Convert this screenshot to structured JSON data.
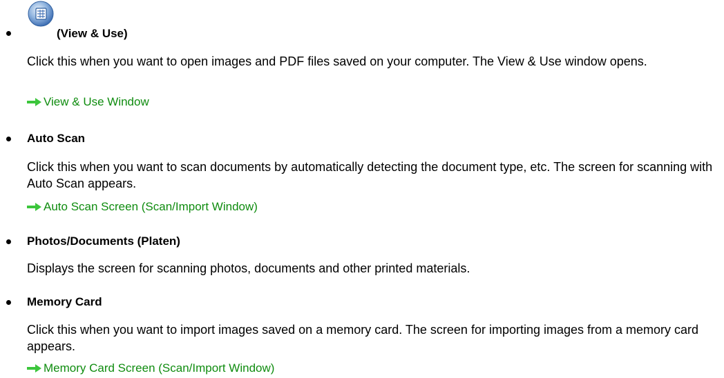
{
  "items": [
    {
      "title": "(View & Use)",
      "icon": "view-and-use-icon",
      "description": "Click this when you want to open images and PDF files saved on your computer. The View & Use window opens.",
      "link": "View & Use Window"
    },
    {
      "title": "Auto Scan",
      "description": "Click this when you want to scan documents by automatically detecting the document type, etc. The screen for scanning with Auto Scan appears.",
      "link": "Auto Scan Screen (Scan/Import Window)"
    },
    {
      "title": "Photos/Documents (Platen)",
      "description": "Displays the screen for scanning photos, documents and other printed materials."
    },
    {
      "title": "Memory Card",
      "description": "Click this when you want to import images saved on a memory card. The screen for importing images from a memory card appears.",
      "link": "Memory Card Screen (Scan/Import Window)"
    }
  ],
  "colors": {
    "link": "#0f8c0f",
    "arrow": "#3cc63c",
    "text": "#000000"
  }
}
